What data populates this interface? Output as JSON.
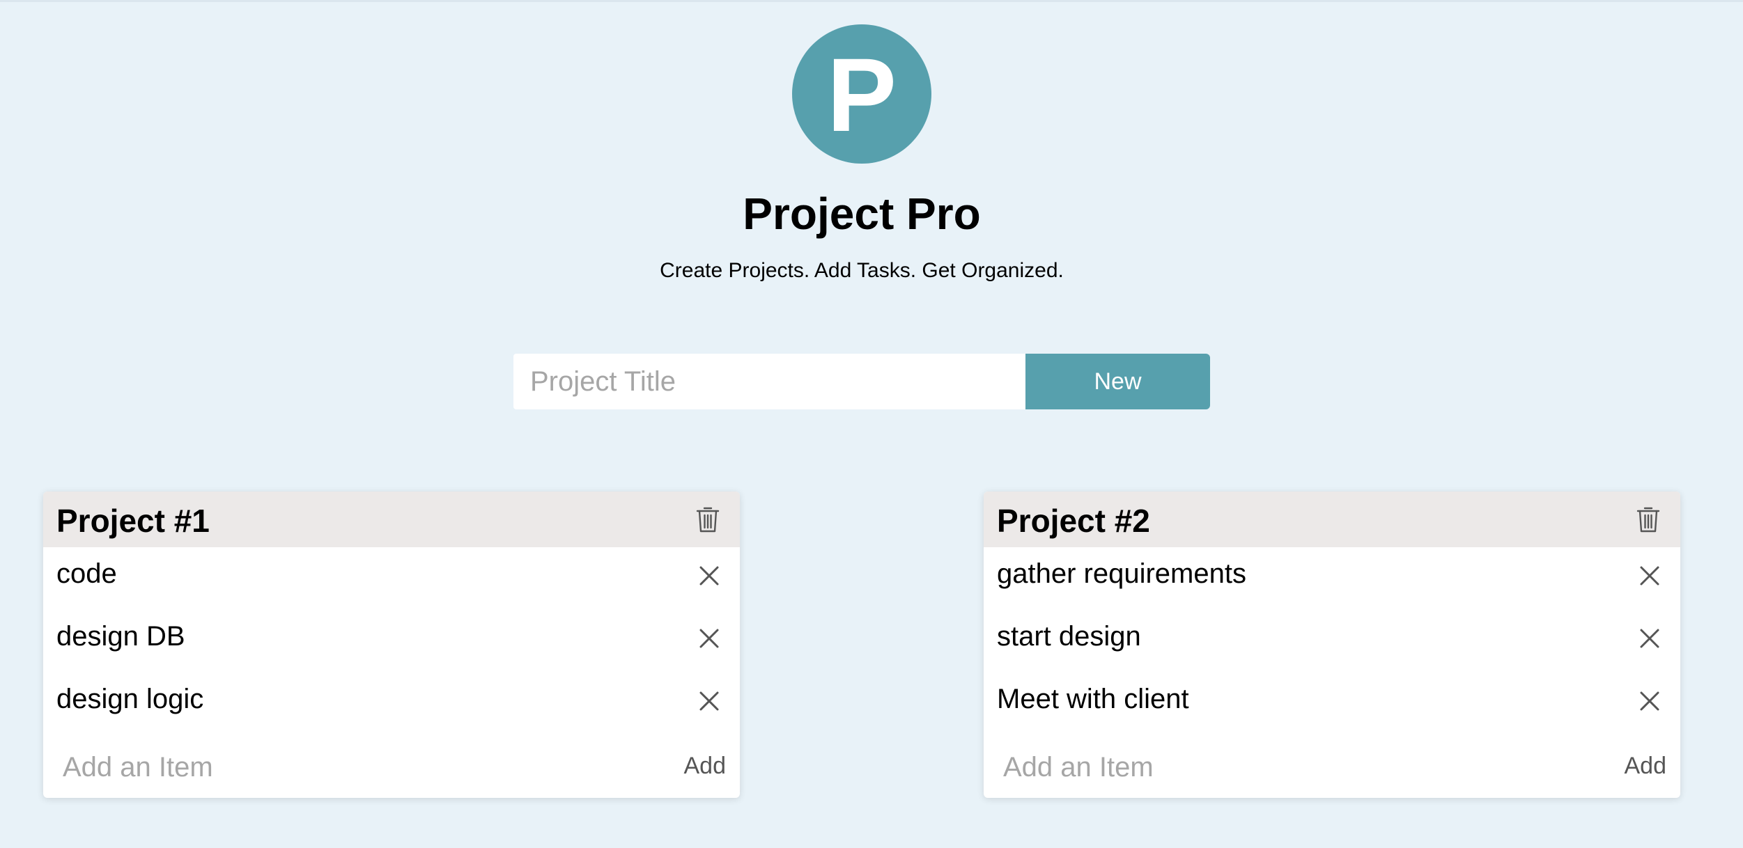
{
  "app": {
    "logo_letter": "P",
    "title": "Project Pro",
    "tagline": "Create Projects. Add Tasks. Get Organized."
  },
  "new_project": {
    "placeholder": "Project Title",
    "value": "",
    "button_label": "New"
  },
  "projects": [
    {
      "title": "Project #1",
      "items": [
        "code",
        "design DB",
        "design logic"
      ],
      "add_placeholder": "Add an Item",
      "add_label": "Add"
    },
    {
      "title": "Project #2",
      "items": [
        "gather requirements",
        "start design",
        "Meet with client"
      ],
      "add_placeholder": "Add an Item",
      "add_label": "Add"
    }
  ],
  "icons": {
    "delete_project": "trash-icon",
    "remove_item": "close-icon"
  },
  "colors": {
    "background": "#e8f2f8",
    "accent": "#57a0ad",
    "card_header": "#ece9e8",
    "card_body": "#ffffff",
    "placeholder": "#a6a6a6",
    "icon": "#555555"
  }
}
